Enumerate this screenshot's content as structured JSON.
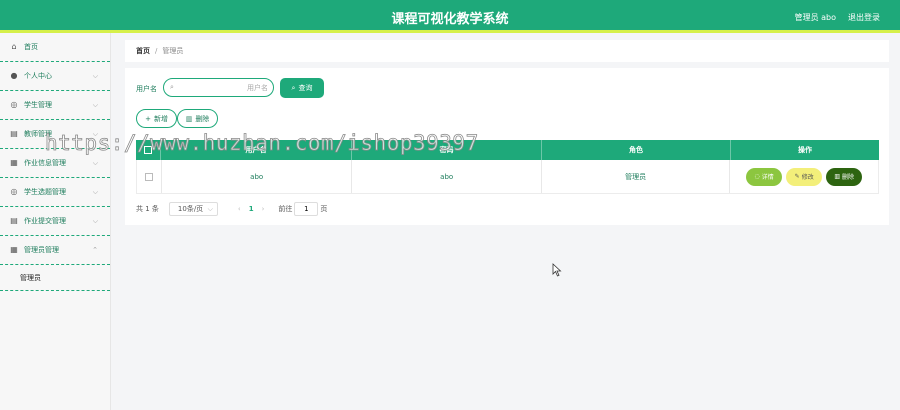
{
  "header": {
    "title": "课程可视化教学系统",
    "user": "管理员 abo",
    "logout": "退出登录"
  },
  "sidebar": {
    "items": [
      {
        "label": "首页",
        "icon": "home-icon"
      },
      {
        "label": "个人中心",
        "icon": "user-icon"
      },
      {
        "label": "学生管理",
        "icon": "compass-icon"
      },
      {
        "label": "教师管理",
        "icon": "doc-icon"
      },
      {
        "label": "作业信息管理",
        "icon": "briefcase-icon"
      },
      {
        "label": "学生选题管理",
        "icon": "compass-icon"
      },
      {
        "label": "作业提交管理",
        "icon": "doc-icon"
      },
      {
        "label": "管理员管理",
        "icon": "briefcase-icon"
      }
    ],
    "sub_item": "管理员"
  },
  "breadcrumb": {
    "home": "首页",
    "separator": "/",
    "current": "管理员"
  },
  "search": {
    "label": "用户名",
    "placeholder": "用户名",
    "query_button": "查询"
  },
  "actions": {
    "add": "新增",
    "delete": "删除"
  },
  "table": {
    "headers": [
      "用户名",
      "密码",
      "角色",
      "操作"
    ],
    "rows": [
      {
        "username": "abo",
        "password": "abo",
        "role": "管理员"
      }
    ],
    "op_labels": {
      "detail": "详情",
      "edit": "修改",
      "remove": "删除"
    }
  },
  "pagination": {
    "total": "共 1 条",
    "page_size": "10条/页",
    "current_page": "1",
    "goto_prefix": "前往",
    "goto_value": "1",
    "goto_suffix": "页"
  },
  "watermark": "https://www.huzhan.com/ishop39397",
  "colors": {
    "primary": "#1ea97a",
    "accent_bar": "#d6f04a",
    "detail_button": "#8cc63f",
    "edit_button": "#f3ef7a",
    "remove_button": "#2d6410"
  }
}
